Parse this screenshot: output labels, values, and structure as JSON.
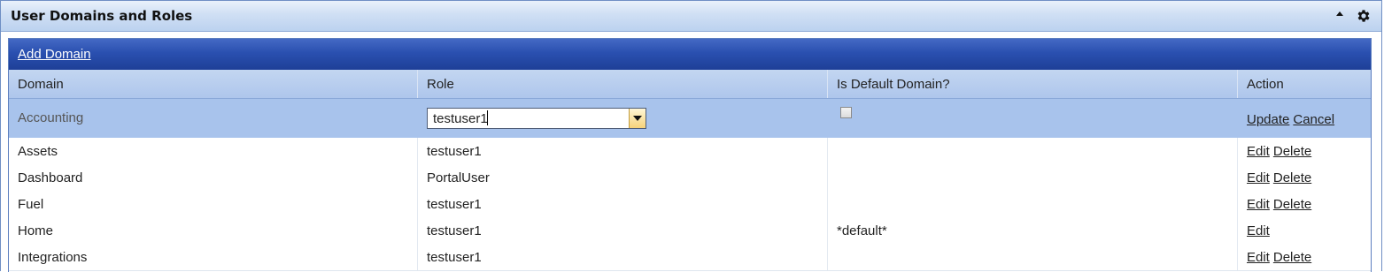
{
  "panel": {
    "title": "User Domains and Roles"
  },
  "toolbar": {
    "add_domain_label": "Add Domain"
  },
  "columns": [
    "Domain",
    "Role",
    "Is Default Domain?",
    "Action"
  ],
  "edit_row": {
    "domain": "Accounting",
    "role_value": "testuser1",
    "is_default": false,
    "actions": [
      "Update",
      "Cancel"
    ]
  },
  "rows": [
    {
      "domain": "Assets",
      "role": "testuser1",
      "default": "",
      "actions": [
        "Edit",
        "Delete"
      ]
    },
    {
      "domain": "Dashboard",
      "role": "PortalUser",
      "default": "",
      "actions": [
        "Edit",
        "Delete"
      ]
    },
    {
      "domain": "Fuel",
      "role": "testuser1",
      "default": "",
      "actions": [
        "Edit",
        "Delete"
      ]
    },
    {
      "domain": "Home",
      "role": "testuser1",
      "default": "*default*",
      "actions": [
        "Edit"
      ]
    },
    {
      "domain": "Integrations",
      "role": "testuser1",
      "default": "",
      "actions": [
        "Edit",
        "Delete"
      ]
    }
  ]
}
